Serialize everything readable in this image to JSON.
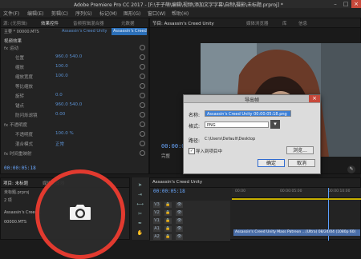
{
  "window": {
    "title": "Adobe Premiere Pro CC 2017 - [F:\\于子萌\\编辑\\视频\\添加文字字幕\\自制\\摄影\\未标题.prproj] *"
  },
  "menu": [
    "文件(F)",
    "编辑(E)",
    "剪辑(C)",
    "序列(S)",
    "标记(M)",
    "图形(G)",
    "窗口(W)",
    "帮助(H)"
  ],
  "source_panel": {
    "tabs": [
      "源: (无剪辑)",
      "效果控件",
      "音频剪辑混合器",
      "元数据"
    ],
    "master": "主要 * 00000.MTS",
    "sequence": "Assassin's Creed Unity",
    "clip_block": "Assassin's Creed Unity",
    "section": "视频效果",
    "rows": [
      {
        "label": "fx 运动",
        "value": ""
      },
      {
        "label": "位置",
        "value": "960.0  540.0"
      },
      {
        "label": "缩放",
        "value": "100.0"
      },
      {
        "label": "缩放宽度",
        "value": "100.0"
      },
      {
        "label": "等比缩放",
        "value": ""
      },
      {
        "label": "旋转",
        "value": "0.0"
      },
      {
        "label": "锚点",
        "value": "960.0  540.0"
      },
      {
        "label": "防闪烁滤镜",
        "value": "0.00"
      },
      {
        "label": "fx 不透明度",
        "value": ""
      },
      {
        "label": "不透明度",
        "value": "100.0 %"
      },
      {
        "label": "混合模式",
        "value": "正常"
      },
      {
        "label": "fx 时间重映射",
        "value": ""
      }
    ],
    "timecode": "00:00:05:18"
  },
  "program_panel": {
    "tabs": [
      "节目: Assassin's Creed Unity",
      "媒体浏览器",
      "库",
      "信息"
    ],
    "timecode": "00:00:05:18",
    "fit": "完整"
  },
  "dialog": {
    "title": "导出帧",
    "name_label": "名称:",
    "name_value": "Assassin's Creed Unity 00:00:05:18.png",
    "format_label": "格式:",
    "format_value": "PNG",
    "path_label": "路径:",
    "path_value": "C:\\Users\\Default\\Desktop",
    "browse_label": "浏览...",
    "import_checkbox_label": "导入到项目中",
    "ok_label": "确定",
    "cancel_label": "取消"
  },
  "project_panel": {
    "tabs": [
      "项目: 未标题",
      "媒体浏览器"
    ],
    "items": [
      "未标题.prproj",
      "Assassin's Creed...",
      "00000.MTS"
    ],
    "item_count": "2 项"
  },
  "timeline": {
    "tab": "Assassin's Creed Unity",
    "timecode": "00:00:05:18",
    "ruler": [
      "00:00",
      "00:00:05:00",
      "00:00:10:00"
    ],
    "tracks": [
      "V3",
      "V2",
      "V1",
      "A1",
      "A2"
    ],
    "clip_label": "Assassin's Creed Unity Mass Patreon ...(Ultra) 08/24/04 (1080p 60)"
  },
  "colors": {
    "accent_blue": "#2b6fb8",
    "timecode_blue": "#6aa8ff",
    "playhead": "#5aa0ff",
    "annotation_red": "#e23a2f",
    "dialog_bg": "#dcdcdc"
  },
  "icons": [
    "camera-icon",
    "close-icon",
    "minimize-icon",
    "maximize-icon",
    "folder-icon",
    "play-icon",
    "wrench-icon",
    "eye-icon",
    "lock-icon",
    "razor-icon",
    "hand-icon",
    "selection-icon"
  ]
}
